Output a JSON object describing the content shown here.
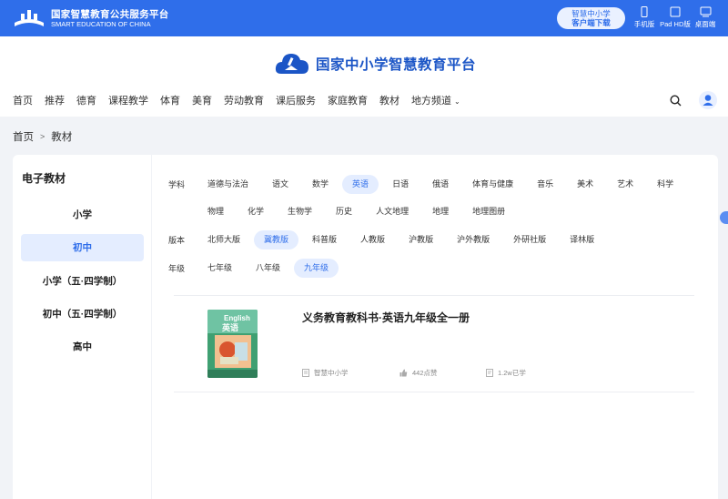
{
  "topbar": {
    "logo_cn": "国家智慧教育公共服务平台",
    "logo_en": "SMART EDUCATION OF CHINA",
    "client_line1": "智慧中小学",
    "client_line2": "客户端下载",
    "devices": [
      "手机版",
      "Pad HD版",
      "桌面端"
    ]
  },
  "header": {
    "brand": "国家中小学智慧教育平台",
    "nav": [
      "首页",
      "推荐",
      "德育",
      "课程教学",
      "体育",
      "美育",
      "劳动教育",
      "课后服务",
      "家庭教育",
      "教材",
      "地方频道"
    ]
  },
  "breadcrumb": {
    "home": "首页",
    "sep": ">",
    "current": "教材"
  },
  "left": {
    "title": "电子教材",
    "stages": [
      "小学",
      "初中",
      "小学（五·四学制）",
      "初中（五·四学制）",
      "高中"
    ],
    "active": "初中"
  },
  "filters": {
    "subject_label": "学科",
    "subjects_row1": [
      "道德与法治",
      "语文",
      "数学",
      "英语",
      "日语",
      "俄语",
      "体育与健康",
      "音乐",
      "美术",
      "艺术",
      "科学"
    ],
    "subjects_row2": [
      "物理",
      "化学",
      "生物学",
      "历史",
      "人文地理",
      "地理",
      "地理图册"
    ],
    "subject_selected": "英语",
    "edition_label": "版本",
    "editions": [
      "北师大版",
      "冀教版",
      "科普版",
      "人教版",
      "沪教版",
      "沪外教版",
      "外研社版",
      "译林版"
    ],
    "edition_selected": "冀教版",
    "grade_label": "年级",
    "grades": [
      "七年级",
      "八年级",
      "九年级"
    ],
    "grade_selected": "九年级"
  },
  "book": {
    "title": "义务教育教科书·英语九年级全一册",
    "cover_word": "English",
    "cover_cn": "英语",
    "source": "智慧中小学",
    "likes": "442点赞",
    "learned": "1.2w已学"
  },
  "colors": {
    "primary": "#2f6eea",
    "chip_bg": "#e4edff",
    "page_bg": "#f1f3f7"
  }
}
